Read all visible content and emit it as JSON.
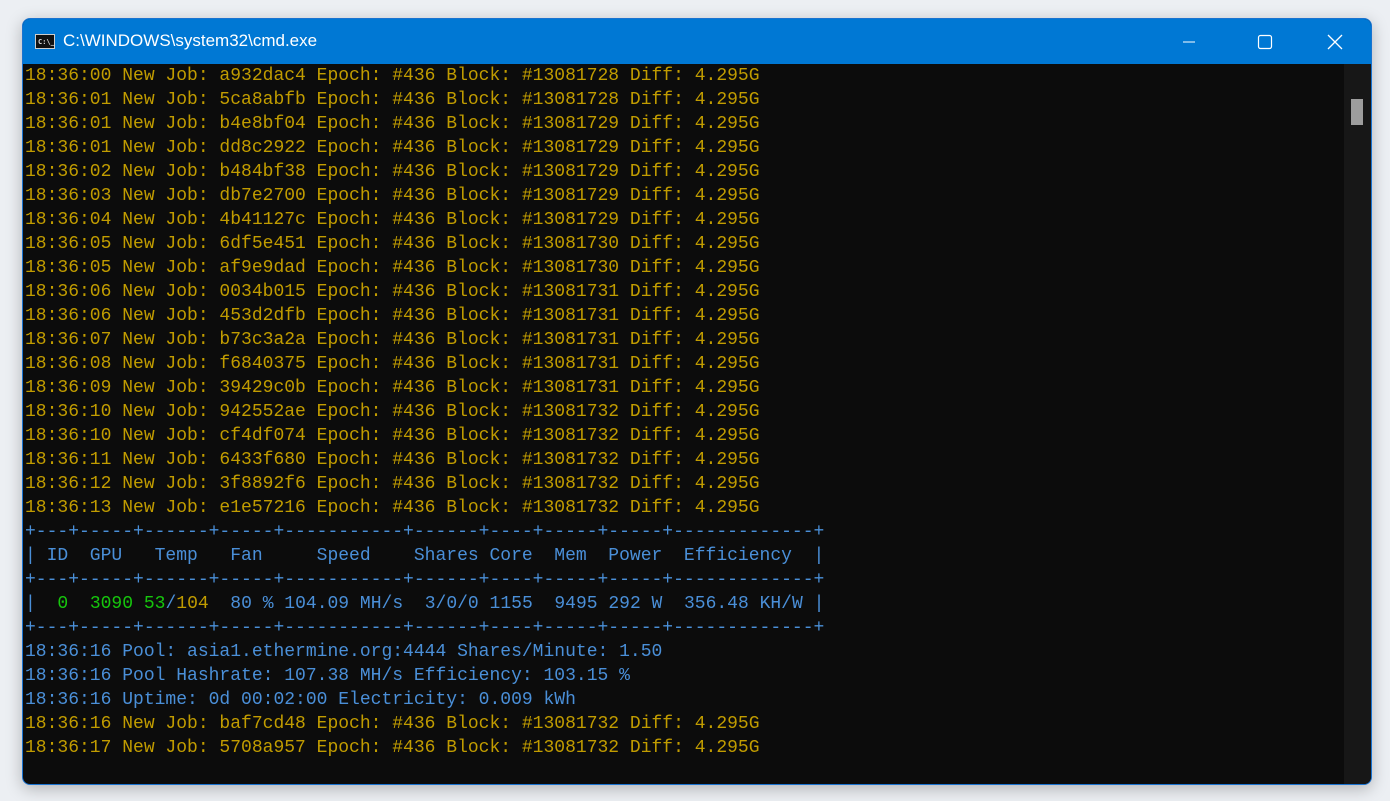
{
  "window": {
    "title": "C:\\WINDOWS\\system32\\cmd.exe",
    "icon_text": "C:\\_"
  },
  "colors": {
    "yellow": "#c19c00",
    "blue": "#4a8fd8",
    "green": "#16c60c",
    "titlebar": "#0078d4"
  },
  "console": {
    "lines": [
      [
        {
          "t": "18:36:00 New Job: a932dac4 Epoch: #436 Block: #13081728 Diff: 4.295G",
          "c": "yellow"
        }
      ],
      [
        {
          "t": "18:36:01 New Job: 5ca8abfb Epoch: #436 Block: #13081728 Diff: 4.295G",
          "c": "yellow"
        }
      ],
      [
        {
          "t": "18:36:01 New Job: b4e8bf04 Epoch: #436 Block: #13081729 Diff: 4.295G",
          "c": "yellow"
        }
      ],
      [
        {
          "t": "18:36:01 New Job: dd8c2922 Epoch: #436 Block: #13081729 Diff: 4.295G",
          "c": "yellow"
        }
      ],
      [
        {
          "t": "18:36:02 New Job: b484bf38 Epoch: #436 Block: #13081729 Diff: 4.295G",
          "c": "yellow"
        }
      ],
      [
        {
          "t": "18:36:03 New Job: db7e2700 Epoch: #436 Block: #13081729 Diff: 4.295G",
          "c": "yellow"
        }
      ],
      [
        {
          "t": "18:36:04 New Job: 4b41127c Epoch: #436 Block: #13081729 Diff: 4.295G",
          "c": "yellow"
        }
      ],
      [
        {
          "t": "18:36:05 New Job: 6df5e451 Epoch: #436 Block: #13081730 Diff: 4.295G",
          "c": "yellow"
        }
      ],
      [
        {
          "t": "18:36:05 New Job: af9e9dad Epoch: #436 Block: #13081730 Diff: 4.295G",
          "c": "yellow"
        }
      ],
      [
        {
          "t": "18:36:06 New Job: 0034b015 Epoch: #436 Block: #13081731 Diff: 4.295G",
          "c": "yellow"
        }
      ],
      [
        {
          "t": "18:36:06 New Job: 453d2dfb Epoch: #436 Block: #13081731 Diff: 4.295G",
          "c": "yellow"
        }
      ],
      [
        {
          "t": "18:36:07 New Job: b73c3a2a Epoch: #436 Block: #13081731 Diff: 4.295G",
          "c": "yellow"
        }
      ],
      [
        {
          "t": "18:36:08 New Job: f6840375 Epoch: #436 Block: #13081731 Diff: 4.295G",
          "c": "yellow"
        }
      ],
      [
        {
          "t": "18:36:09 New Job: 39429c0b Epoch: #436 Block: #13081731 Diff: 4.295G",
          "c": "yellow"
        }
      ],
      [
        {
          "t": "18:36:10 New Job: 942552ae Epoch: #436 Block: #13081732 Diff: 4.295G",
          "c": "yellow"
        }
      ],
      [
        {
          "t": "18:36:10 New Job: cf4df074 Epoch: #436 Block: #13081732 Diff: 4.295G",
          "c": "yellow"
        }
      ],
      [
        {
          "t": "18:36:11 New Job: 6433f680 Epoch: #436 Block: #13081732 Diff: 4.295G",
          "c": "yellow"
        }
      ],
      [
        {
          "t": "18:36:12 New Job: 3f8892f6 Epoch: #436 Block: #13081732 Diff: 4.295G",
          "c": "yellow"
        }
      ],
      [
        {
          "t": "18:36:13 New Job: e1e57216 Epoch: #436 Block: #13081732 Diff: 4.295G",
          "c": "yellow"
        }
      ],
      [
        {
          "t": "+---+-----+------+-----+-----------+------+----+-----+-----+-------------+",
          "c": "blue"
        }
      ],
      [
        {
          "t": "| ID  GPU   Temp   Fan     Speed    Shares Core  Mem  Power  Efficiency  |",
          "c": "blue"
        }
      ],
      [
        {
          "t": "+---+-----+------+-----+-----------+------+----+-----+-----+-------------+",
          "c": "blue"
        }
      ],
      [
        {
          "t": "|  ",
          "c": "blue"
        },
        {
          "t": "0",
          "c": "green"
        },
        {
          "t": "  ",
          "c": "blue"
        },
        {
          "t": "3090",
          "c": "green"
        },
        {
          "t": " ",
          "c": "blue"
        },
        {
          "t": "53",
          "c": "green"
        },
        {
          "t": "/",
          "c": "blue"
        },
        {
          "t": "104",
          "c": "yellow"
        },
        {
          "t": "  80 % 104.09 MH/s  3/0/0 1155  9495 292 W  356.48 KH/W |",
          "c": "blue"
        }
      ],
      [
        {
          "t": "+---+-----+------+-----+-----------+------+----+-----+-----+-------------+",
          "c": "blue"
        }
      ],
      [
        {
          "t": "18:36:16 Pool: asia1.ethermine.org:4444 Shares/Minute: 1.50",
          "c": "blue"
        }
      ],
      [
        {
          "t": "18:36:16 Pool Hashrate: 107.38 MH/s Efficiency: 103.15 %",
          "c": "blue"
        }
      ],
      [
        {
          "t": "18:36:16 Uptime: 0d 00:02:00 Electricity: 0.009 kWh",
          "c": "blue"
        }
      ],
      [
        {
          "t": "18:36:16 New Job: baf7cd48 Epoch: #436 Block: #13081732 Diff: 4.295G",
          "c": "yellow"
        }
      ],
      [
        {
          "t": "18:36:17 New Job: 5708a957 Epoch: #436 Block: #13081732 Diff: 4.295G",
          "c": "yellow"
        }
      ]
    ]
  }
}
